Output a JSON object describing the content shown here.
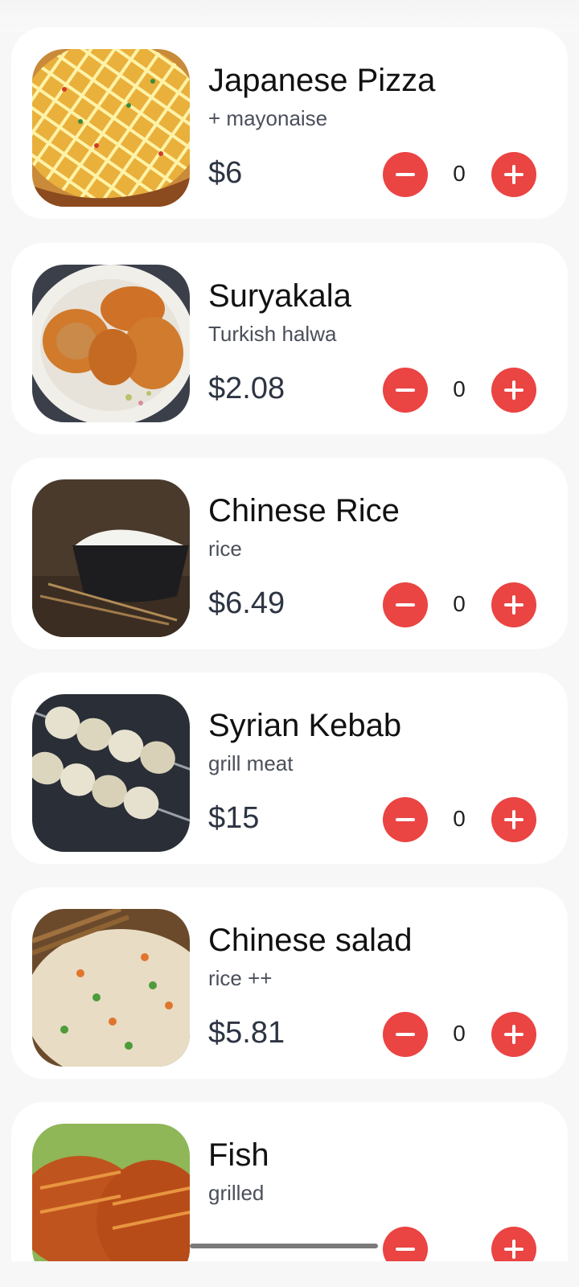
{
  "menu": {
    "items": [
      {
        "name": "Japanese Pizza",
        "description": "+ mayonaise",
        "price": "$6",
        "quantity": "0",
        "image_icon": "pizza-photo"
      },
      {
        "name": "Suryakala",
        "description": "Turkish halwa",
        "price": "$2.08",
        "quantity": "0",
        "image_icon": "sweet-pastry-photo"
      },
      {
        "name": "Chinese Rice",
        "description": "rice",
        "price": "$6.49",
        "quantity": "0",
        "image_icon": "rice-bowl-photo"
      },
      {
        "name": "Syrian Kebab",
        "description": "grill meat",
        "price": "$15",
        "quantity": "0",
        "image_icon": "kebab-skewer-photo"
      },
      {
        "name": "Chinese salad",
        "description": "rice ++",
        "price": "$5.81",
        "quantity": "0",
        "image_icon": "fried-rice-photo"
      },
      {
        "name": "Fish",
        "description": "grilled",
        "price": "",
        "quantity": "",
        "image_icon": "grilled-fish-photo"
      }
    ]
  },
  "colors": {
    "accent": "#ea4443",
    "card_background": "#ffffff",
    "page_background": "#f7f7f8",
    "price_text": "#2d3442"
  },
  "icons": {
    "decrease": "minus-icon",
    "increase": "plus-icon"
  }
}
